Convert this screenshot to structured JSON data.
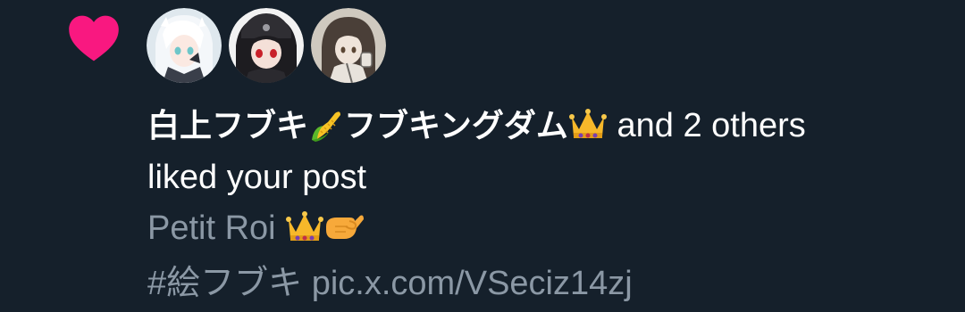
{
  "notification": {
    "type_icon": "heart-icon",
    "accent_color": "#f91880",
    "avatars": [
      {
        "name": "avatar-1",
        "bg": "#dfe8ee"
      },
      {
        "name": "avatar-2",
        "bg": "#2b2a2e"
      },
      {
        "name": "avatar-3",
        "bg": "#cfc9bf"
      }
    ],
    "actor_name_part1": "白上フブキ",
    "actor_emoji_1": "corn-emoji",
    "actor_name_part2": "フブキングダム",
    "actor_emoji_2": "crown-emoji",
    "others_text": " and 2 others",
    "action_text": "liked your post",
    "post_preview": {
      "text": "Petit Roi ",
      "emoji_1": "crown-emoji",
      "emoji_2": "pinching-hand-emoji"
    },
    "hashtag_line": "#絵フブキ pic.x.com/VSeciz14zj"
  }
}
